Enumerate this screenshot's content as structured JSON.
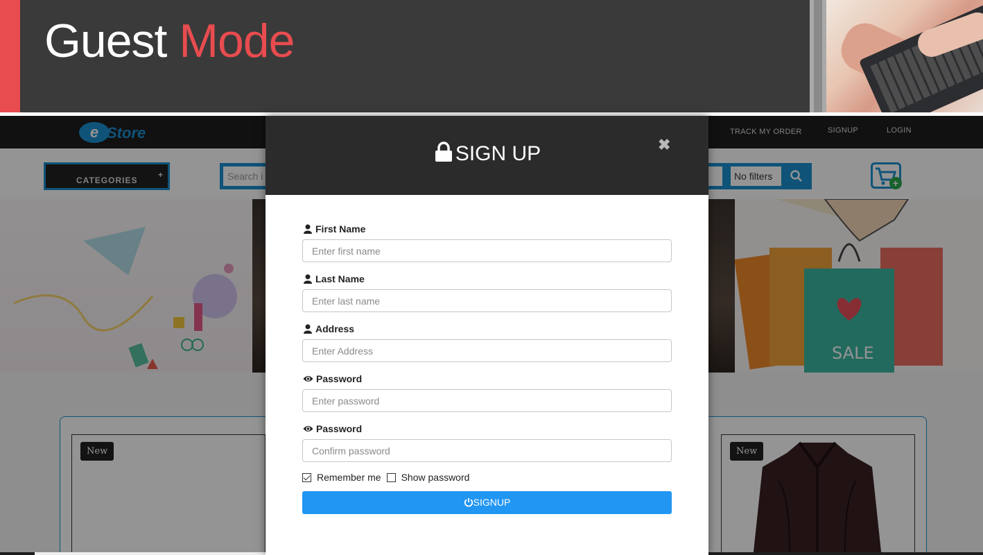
{
  "banner": {
    "title_part1": "Guest ",
    "title_part2": "Mode",
    "accent_color": "#e84c4f"
  },
  "site": {
    "logo_text": "Store",
    "logo_mark": "e",
    "nav_links": [
      "TRACK MY ORDER",
      "SIGNUP",
      "LOGIN"
    ],
    "categories_label": "CATEGORIES",
    "categories_icon": "plus-icon",
    "search_placeholder": "Search i",
    "filter_label": "No filters",
    "search_icon": "search-icon",
    "cart_icon": "cart-add-icon",
    "products": [
      {
        "badge": "New"
      },
      {
        "badge": "New"
      }
    ],
    "brand_color": "#1a8fd0"
  },
  "modal": {
    "title": "SIGN UP",
    "title_icon": "lock-icon",
    "close_icon": "close-icon",
    "fields": [
      {
        "label": "First Name",
        "icon": "user-icon",
        "placeholder": "Enter first name",
        "value": ""
      },
      {
        "label": "Last Name",
        "icon": "user-icon",
        "placeholder": "Enter last name",
        "value": ""
      },
      {
        "label": "Address",
        "icon": "user-icon",
        "placeholder": "Enter Address",
        "value": ""
      },
      {
        "label": "Password",
        "icon": "eye-icon",
        "placeholder": "Enter password",
        "value": ""
      },
      {
        "label": "Password",
        "icon": "eye-icon",
        "placeholder": "Confirm password",
        "value": ""
      }
    ],
    "remember_me": {
      "label": "Remember me",
      "checked": true
    },
    "show_password": {
      "label": "Show password",
      "checked": false
    },
    "submit": {
      "label": "SIGNUP",
      "icon": "power-icon",
      "color": "#2196f3"
    }
  }
}
